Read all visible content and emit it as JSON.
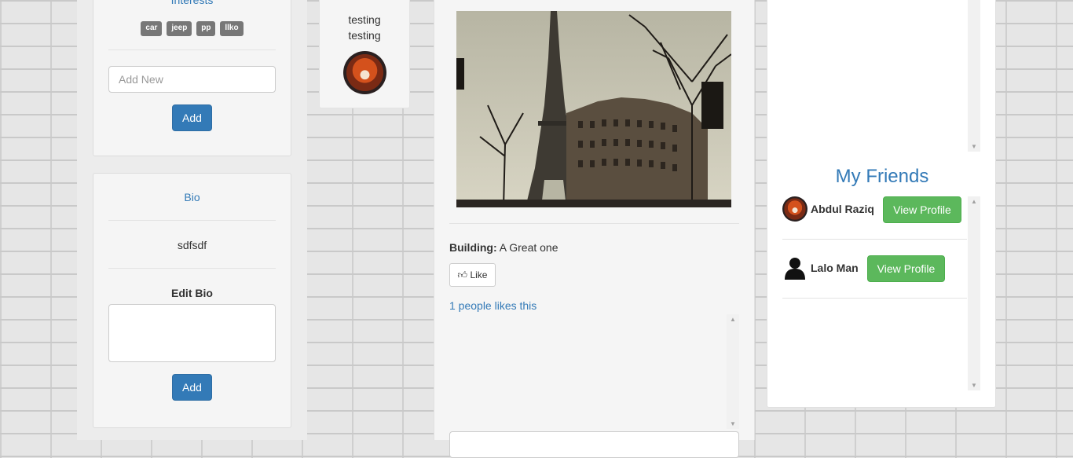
{
  "left": {
    "interests_title": "Interests",
    "tags": [
      "car",
      "jeep",
      "pp",
      "llko"
    ],
    "add_new_placeholder": "Add New",
    "add_label": "Add",
    "bio_title": "Bio",
    "bio_text": "sdfsdf",
    "edit_bio_label": "Edit Bio",
    "edit_bio_add_label": "Add"
  },
  "user_card": {
    "name_line1": "testing",
    "name_line2": "testing"
  },
  "post": {
    "image_alt": "Eiffel Tower street photo",
    "building_label": "Building:",
    "building_value": "A Great one",
    "like_label": "Like",
    "likes_text": "1 people likes this"
  },
  "friends": {
    "title": "My Friends",
    "items": [
      {
        "name": "Abdul Raziq",
        "button": "View Profile"
      },
      {
        "name": "Lalo Man",
        "button": "View Profile"
      }
    ]
  },
  "colors": {
    "link": "#337ab7",
    "primary": "#337ab7",
    "success": "#5cb85c",
    "tag": "#777777"
  }
}
